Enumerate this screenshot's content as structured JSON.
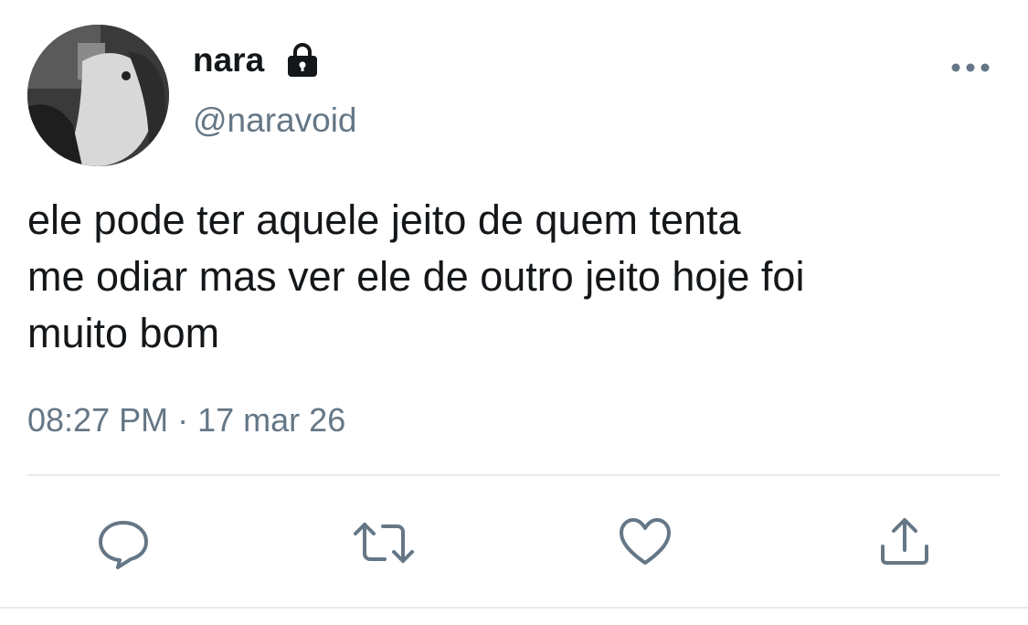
{
  "tweet": {
    "display_name": "nara",
    "handle": "@naravoid",
    "text": "ele pode ter aquele jeito de quem tenta\nme odiar mas ver ele de outro jeito hoje foi\nmuito bom",
    "time": "08:27 PM",
    "separator": "·",
    "date": "17 mar 26",
    "protected": true
  },
  "icons": {
    "lock": "lock-icon",
    "more": "more-horizontal-icon",
    "reply": "reply-icon",
    "retweet": "retweet-icon",
    "like": "heart-icon",
    "share": "share-icon"
  },
  "colors": {
    "text_primary": "#14171a",
    "text_secondary": "#657786",
    "divider": "#e6ecf0",
    "icon": "#657786"
  }
}
